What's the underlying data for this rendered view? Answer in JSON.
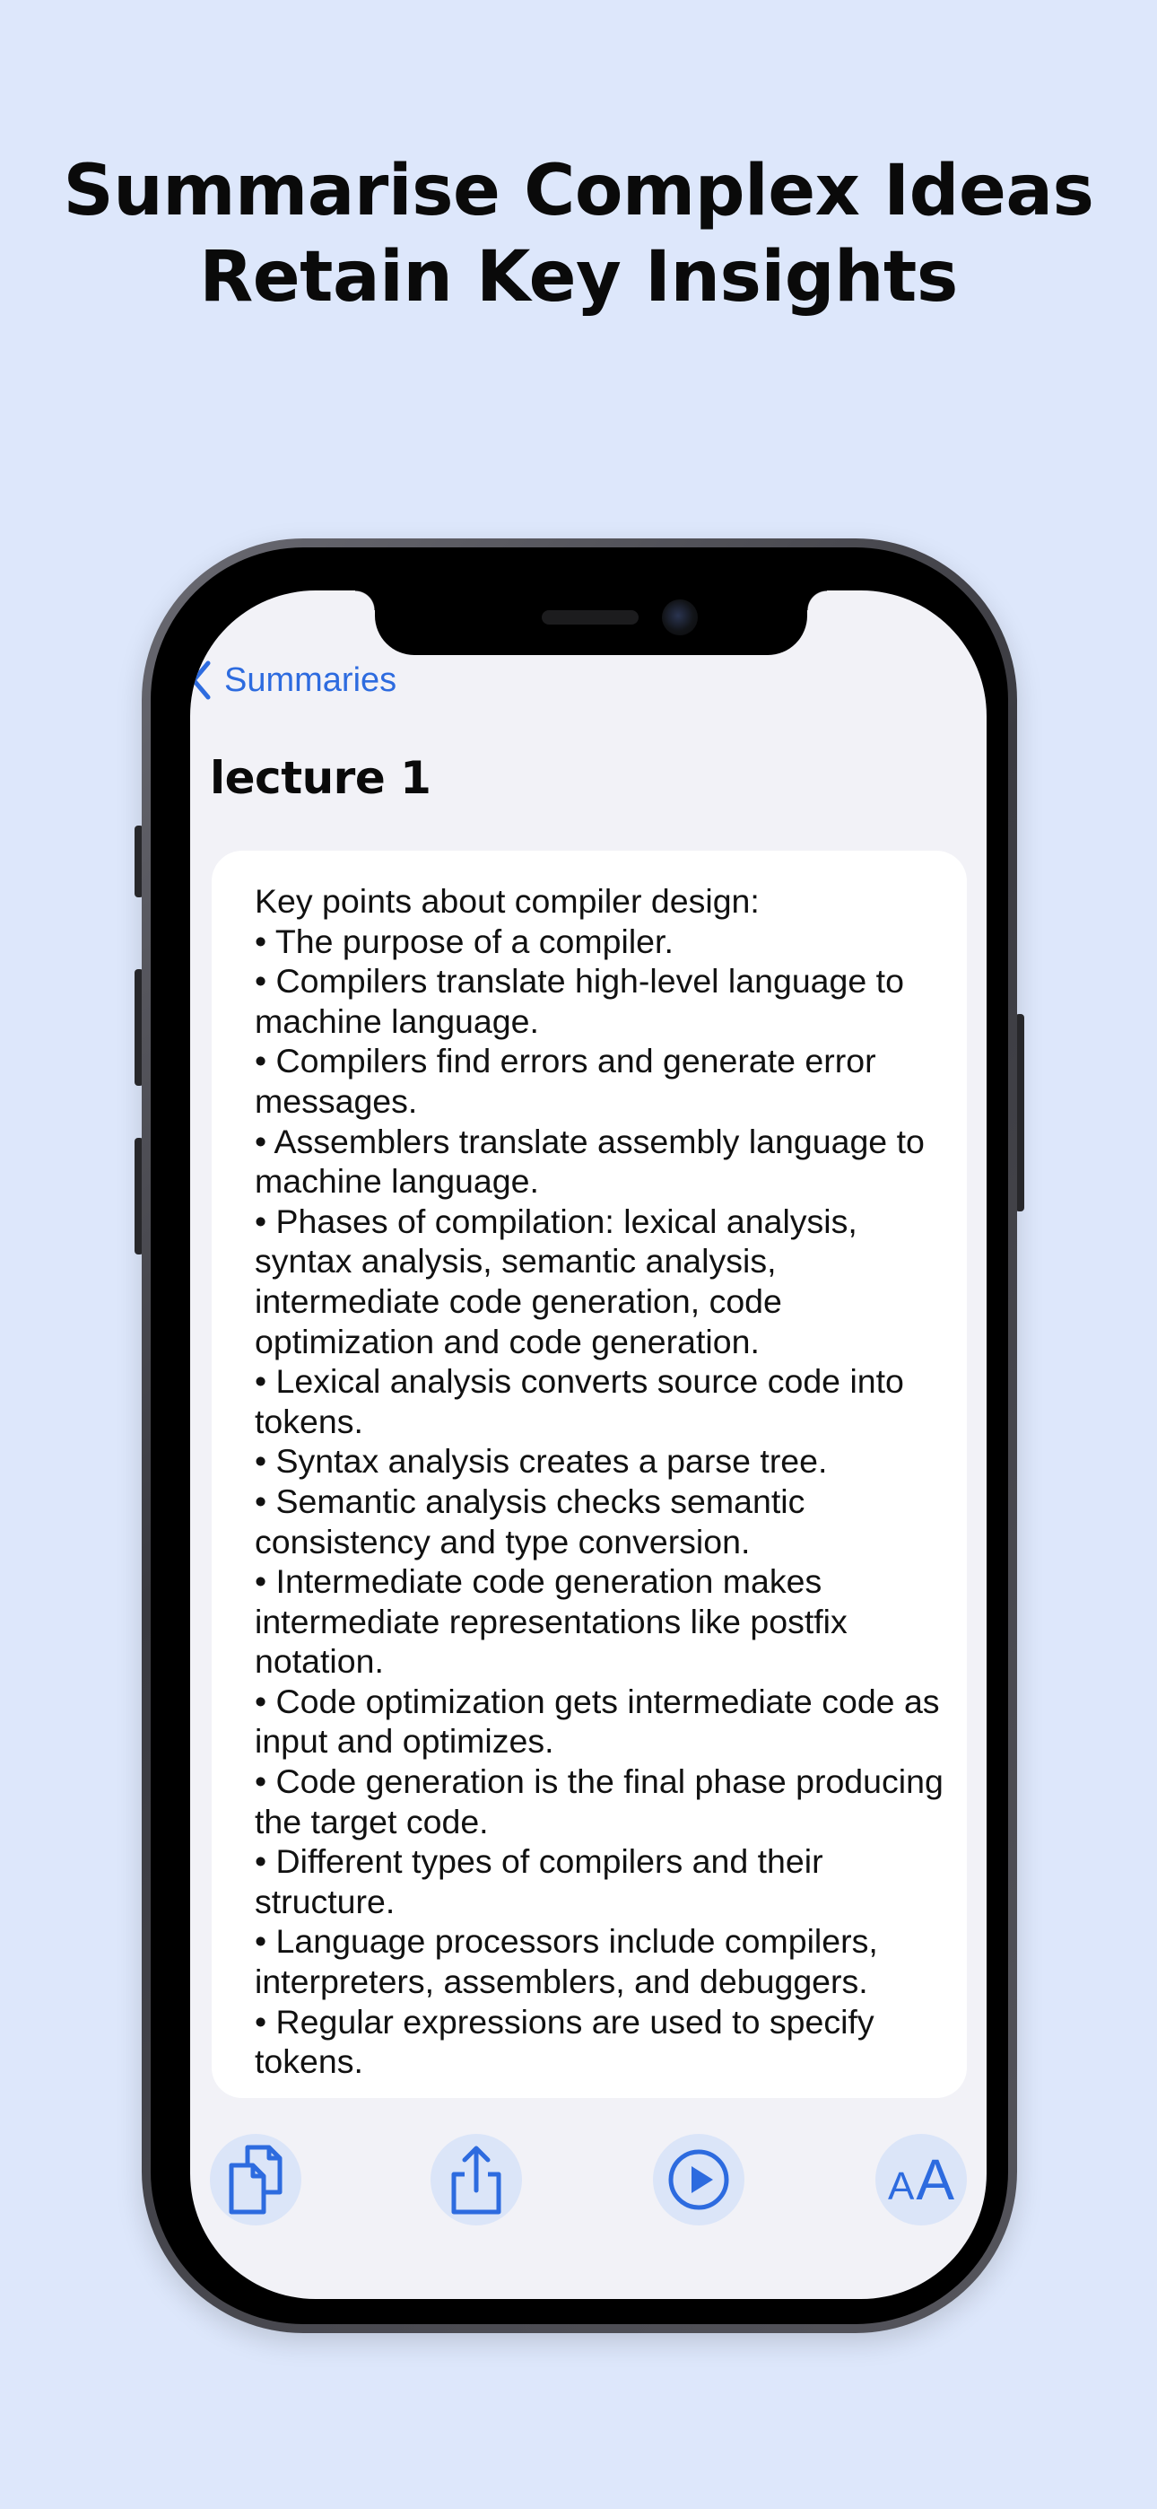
{
  "headline": {
    "line1": "Summarise Complex Ideas",
    "line2": "Retain Key Insights"
  },
  "nav": {
    "back_label": "Summaries"
  },
  "page_title": "lecture 1",
  "summary_lines": [
    "Key points about compiler design:",
    "• The purpose of a compiler.",
    "• Compilers translate high-level language to machine language.",
    "• Compilers find errors and generate error messages.",
    "• Assemblers translate assembly language to machine language.",
    "• Phases of compilation: lexical analysis, syntax analysis, semantic analysis, intermediate code generation, code optimization and code generation.",
    "• Lexical analysis converts source code into tokens.",
    "• Syntax analysis creates a parse tree.",
    "• Semantic analysis checks semantic consistency and type conversion.",
    "• Intermediate code generation makes intermediate representations like postfix notation.",
    "• Code optimization gets intermediate code as input and optimizes.",
    "• Code generation is the final phase producing the target code.",
    "• Different types of compilers and their structure.",
    "• Language processors include compilers, interpreters, assemblers, and debuggers.",
    "• Regular expressions are used to specify tokens."
  ],
  "toolbar": {
    "copy_icon": "copy-icon",
    "share_icon": "share-icon",
    "play_icon": "play-icon",
    "text_size_small": "A",
    "text_size_big": "A"
  },
  "colors": {
    "background": "#dde7fb",
    "accent": "#2d6bdf",
    "screen": "#f2f2f7",
    "card": "#ffffff",
    "tool_bg": "#dbe5f8"
  }
}
